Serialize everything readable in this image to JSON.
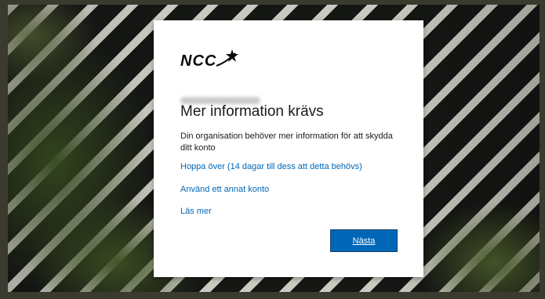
{
  "brand": {
    "logo_text": "NCC",
    "accent": "#0067b8"
  },
  "dialog": {
    "title": "Mer information krävs",
    "description": "Din organisation behöver mer information för att skydda ditt konto",
    "links": {
      "skip": "Hoppa över (14 dagar till dess att detta behövs)",
      "other_account": "Använd ett annat konto",
      "learn_more": "Läs mer"
    },
    "next_label": "Nästa"
  }
}
